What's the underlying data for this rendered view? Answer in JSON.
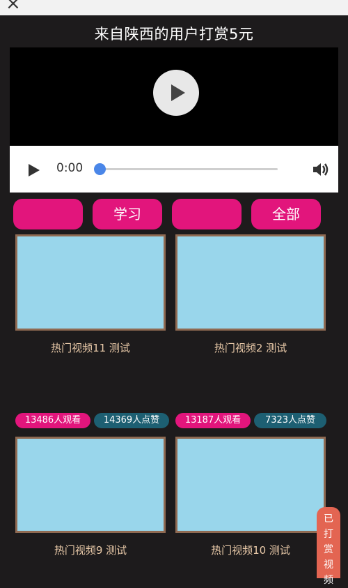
{
  "topbar": {
    "close": "×",
    "right_mark": "⋯"
  },
  "title": "来自陕西的用户打赏5元",
  "player": {
    "time": "0:00",
    "progress": 0
  },
  "categories": [
    {
      "label": ""
    },
    {
      "label": "学习"
    },
    {
      "label": ""
    },
    {
      "label": "全部"
    }
  ],
  "cards": [
    {
      "title": "热门视频11 测试"
    },
    {
      "title": "热门视频2 测试"
    },
    {
      "title": "热门视频9 测试",
      "views": "13486人观看",
      "likes": "14369人点赞"
    },
    {
      "title": "热门视频10 测试",
      "views": "13187人观看",
      "likes": "7323人点赞"
    }
  ],
  "side_tab": {
    "chars": [
      "已",
      "打",
      "赏",
      "视",
      "频"
    ]
  }
}
